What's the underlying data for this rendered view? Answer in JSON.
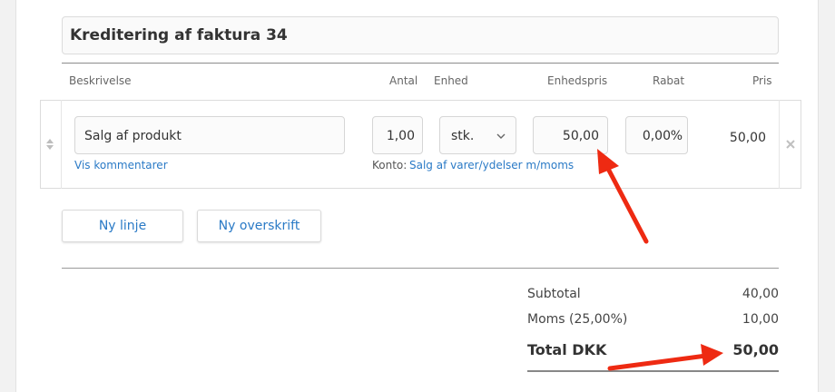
{
  "header": {
    "title": "Kreditering af faktura 34"
  },
  "columns": {
    "description": "Beskrivelse",
    "quantity": "Antal",
    "unit": "Enhed",
    "unit_price": "Enhedspris",
    "discount": "Rabat",
    "price": "Pris"
  },
  "line": {
    "description": "Salg af produkt",
    "quantity": "1,00",
    "unit": "stk.",
    "unit_price": "50,00",
    "discount": "0,00",
    "discount_suffix": "%",
    "price": "50,00",
    "comments_link": "Vis kommentarer",
    "account_label": "Konto:",
    "account_link": "Salg af varer/ydelser m/moms"
  },
  "buttons": {
    "new_line": "Ny linje",
    "new_heading": "Ny overskrift"
  },
  "totals": {
    "subtotal_label": "Subtotal",
    "subtotal_value": "40,00",
    "vat_label": "Moms (25,00%)",
    "vat_value": "10,00",
    "total_label": "Total DKK",
    "total_value": "50,00"
  },
  "icons": {
    "drag": "sort-handle-icon",
    "select": "chevron-down-icon",
    "remove": "close-icon",
    "annotations": "red-arrow-icon"
  },
  "colors": {
    "link": "#2a7ac6",
    "annotation_arrow": "#ee2a12"
  }
}
